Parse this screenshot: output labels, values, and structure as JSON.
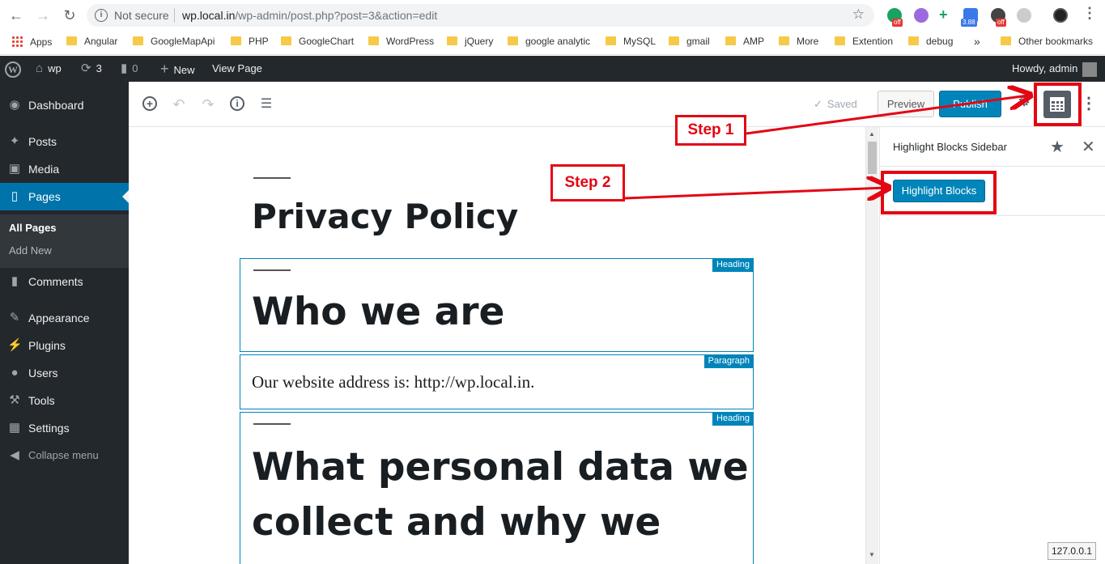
{
  "browser": {
    "security_label": "Not secure",
    "url_host": "wp.local.in",
    "url_rest": "/wp-admin/post.php?post=3&action=edit",
    "ext_badge_off": "off",
    "ext_badge_count": "3.88"
  },
  "bookmarks": {
    "apps": "Apps",
    "items": [
      "Angular",
      "GoogleMapApi",
      "PHP",
      "GoogleChart",
      "WordPress",
      "jQuery",
      "google analytic",
      "MySQL",
      "gmail",
      "AMP",
      "More",
      "Extention",
      "debug"
    ],
    "overflow": "»",
    "other": "Other bookmarks"
  },
  "adminbar": {
    "site_name": "wp",
    "updates_count": "3",
    "comments_count": "0",
    "new_label": "New",
    "view_page": "View Page",
    "howdy": "Howdy, admin"
  },
  "sidebar": {
    "items": [
      {
        "label": "Dashboard",
        "icon": "dashboard-icon"
      },
      {
        "label": "Posts",
        "icon": "pin-icon"
      },
      {
        "label": "Media",
        "icon": "media-icon"
      },
      {
        "label": "Pages",
        "icon": "pages-icon"
      },
      {
        "label": "Comments",
        "icon": "comments-icon"
      },
      {
        "label": "Appearance",
        "icon": "appearance-icon"
      },
      {
        "label": "Plugins",
        "icon": "plugins-icon"
      },
      {
        "label": "Users",
        "icon": "users-icon"
      },
      {
        "label": "Tools",
        "icon": "tools-icon"
      },
      {
        "label": "Settings",
        "icon": "settings-icon"
      },
      {
        "label": "Collapse menu",
        "icon": "collapse-icon"
      }
    ],
    "submenu": [
      "All Pages",
      "Add New"
    ]
  },
  "editor": {
    "saved_label": "Saved",
    "preview_label": "Preview",
    "publish_label": "Publish",
    "page_title": "Privacy Policy",
    "blocks": [
      {
        "type_label": "Heading",
        "text": "Who we are"
      },
      {
        "type_label": "Paragraph",
        "text": "Our website address is: http://wp.local.in."
      },
      {
        "type_label": "Heading",
        "line1": "What personal data we",
        "line2": "collect and why we"
      }
    ]
  },
  "plugin_sidebar": {
    "title": "Highlight Blocks Sidebar",
    "button_label": "Highlight Blocks"
  },
  "annotations": {
    "step1": "Step 1",
    "step2": "Step 2"
  },
  "status_tip": "127.0.0.1",
  "colors": {
    "wp_dark": "#23282d",
    "wp_blue": "#0085ba",
    "annotation_red": "#e30613"
  }
}
